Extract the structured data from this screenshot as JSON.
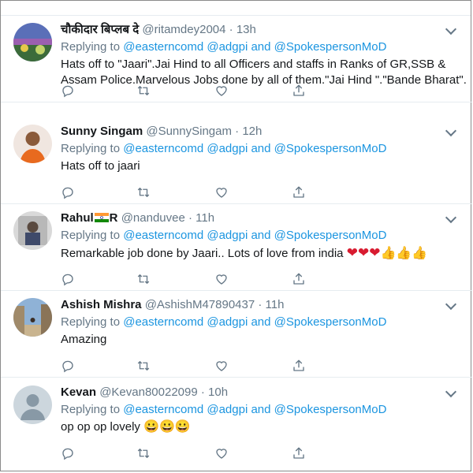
{
  "tweets": [
    {
      "name": "चौकीदार बिप्लब दे",
      "handle": "@ritamdey2004",
      "dot": "·",
      "time": "13h",
      "replying_prefix": "Replying to",
      "mentions": [
        "@easterncomd",
        "@adgpi",
        "and",
        "@SpokespersonMoD"
      ],
      "text": "Hats off to \"Jaari\".Jai Hind to all Officers and staffs in Ranks of GR,SSB &",
      "text2": "Assam Police.Marvelous Jobs done by all of them.\"Jai Hind \".\"Bande Bharat\"."
    },
    {
      "name": "Sunny Singam",
      "handle": "@SunnySingam",
      "dot": "·",
      "time": "12h",
      "replying_prefix": "Replying to",
      "mentions": [
        "@easterncomd",
        "@adgpi",
        "and",
        "@SpokespersonMoD"
      ],
      "text": "Hats off to jaari"
    },
    {
      "name_before": "Rahul",
      "name_after": "R",
      "handle": "@nanduvee",
      "dot": "·",
      "time": "11h",
      "replying_prefix": "Replying to",
      "mentions": [
        "@easterncomd",
        "@adgpi",
        "and",
        "@SpokespersonMoD"
      ],
      "text": "Remarkable job done by Jaari.. Lots of love from india",
      "hearts": "❤❤❤",
      "thumbs": "👍👍👍"
    },
    {
      "name": "Ashish Mishra",
      "handle": "@AshishM47890437",
      "dot": "·",
      "time": "11h",
      "replying_prefix": "Replying to",
      "mentions": [
        "@easterncomd",
        "@adgpi",
        "and",
        "@SpokespersonMoD"
      ],
      "text": "Amazing"
    },
    {
      "name": "Kevan",
      "handle": "@Kevan80022099",
      "dot": "·",
      "time": "10h",
      "replying_prefix": "Replying to",
      "mentions": [
        "@easterncomd",
        "@adgpi",
        "and",
        "@SpokespersonMoD"
      ],
      "text": "op op op lovely",
      "smileys": "😀😀😀"
    }
  ],
  "colors": {
    "link": "#1b95e0",
    "muted": "#657786",
    "text": "#14171a",
    "divider": "#e6ecf0"
  },
  "icons": [
    "reply-icon",
    "retweet-icon",
    "like-icon",
    "share-icon",
    "chevron-down-icon"
  ]
}
